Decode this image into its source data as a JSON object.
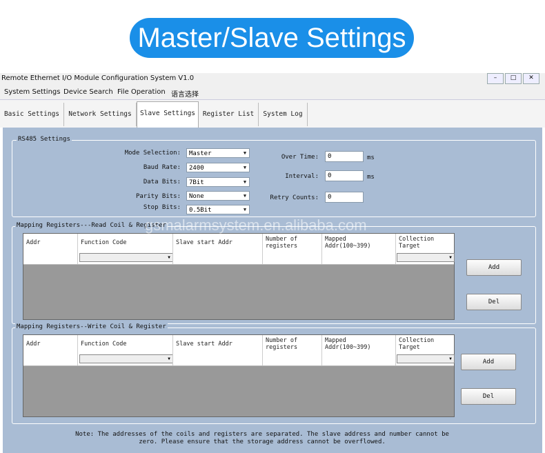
{
  "banner": {
    "title": "Master/Slave Settings"
  },
  "window": {
    "title": "Remote Ethernet I/O Module Configuration System V1.0"
  },
  "menu": [
    "System Settings",
    "Device Search",
    "File Operation",
    "语言选择"
  ],
  "tabs": [
    "Basic Settings",
    "Network Settings",
    "Slave Settings",
    "Register List",
    "System Log"
  ],
  "active_tab": "Slave Settings",
  "rs485": {
    "legend": "RS485 Settings",
    "mode_label": "Mode Selection:",
    "mode_value": "Master",
    "baud_label": "Baud Rate:",
    "baud_value": "2400",
    "data_label": "Data Bits:",
    "data_value": "7Bit",
    "parity_label": "Parity Bits:",
    "parity_value": "None",
    "stop_label": "Stop Bits:",
    "stop_value": "0.5Bit",
    "overtime_label": "Over Time:",
    "overtime_value": "0",
    "overtime_unit": "ms",
    "interval_label": "Interval:",
    "interval_value": "0",
    "interval_unit": "ms",
    "retry_label": "Retry Counts:",
    "retry_value": "0"
  },
  "read_group": {
    "legend": "Mapping Registers---Read Coil & Register",
    "columns": [
      "Addr",
      "Function Code",
      "Slave start Addr",
      "Number of registers",
      "Mapped Addr(100~399)",
      "Collection Target"
    ],
    "add_label": "Add",
    "del_label": "Del"
  },
  "write_group": {
    "legend": "Mapping Registers--Write Coil & Register",
    "columns": [
      "Addr",
      "Function Code",
      "Slave start Addr",
      "Number of registers",
      "Mapped Addr(100~399)",
      "Collection Target"
    ],
    "add_label": "Add",
    "del_label": "Del"
  },
  "note": "Note: The addresses of the coils and registers are separated. The slave address and number cannot be zero. Please ensure that the storage address cannot be overflowed.",
  "watermark": "gsmalarmsystem.en.alibaba.com"
}
